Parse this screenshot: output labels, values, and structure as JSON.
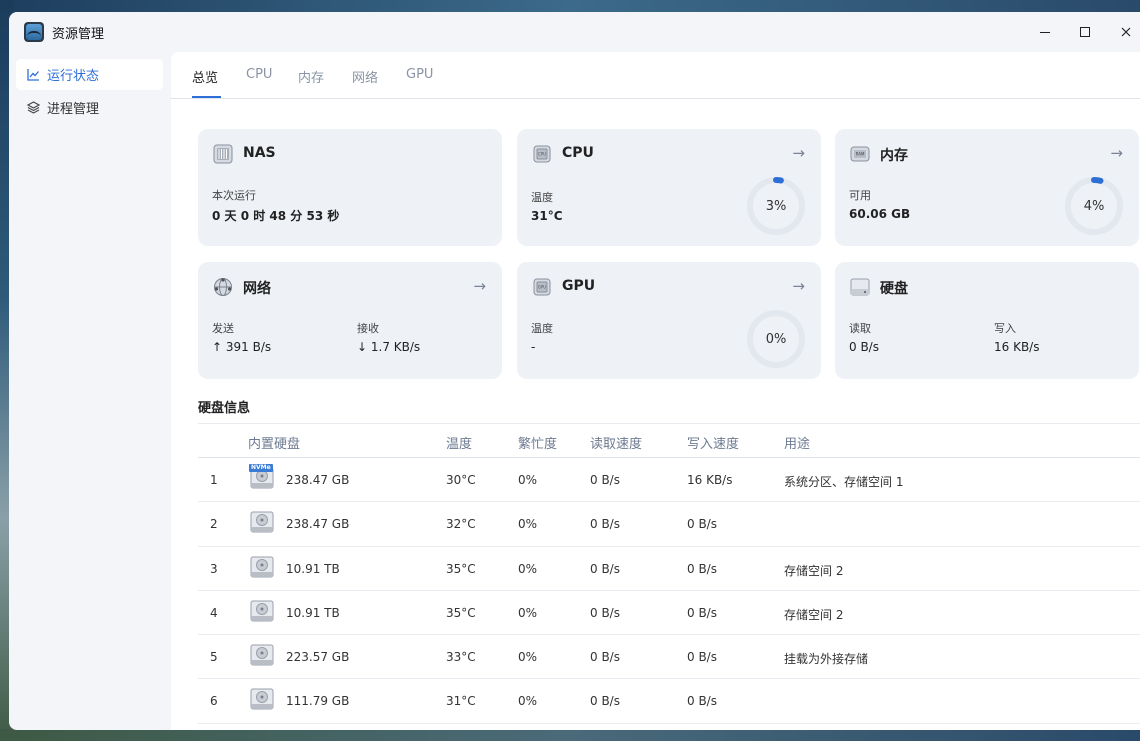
{
  "app": {
    "title": "资源管理"
  },
  "sidebar": {
    "items": [
      {
        "label": "运行状态",
        "icon": "chart-line-icon",
        "active": true
      },
      {
        "label": "进程管理",
        "icon": "layers-icon",
        "active": false
      }
    ]
  },
  "tabs": [
    {
      "label": "总览",
      "active": true
    },
    {
      "label": "CPU",
      "active": false
    },
    {
      "label": "内存",
      "active": false
    },
    {
      "label": "网络",
      "active": false
    },
    {
      "label": "GPU",
      "active": false
    }
  ],
  "cards": {
    "nas": {
      "title": "NAS",
      "label": "本次运行",
      "value": "0 天 0 时 48 分 53 秒"
    },
    "cpu": {
      "title": "CPU",
      "label": "温度",
      "value": "31°C",
      "percent_text": "3%",
      "percent": 3
    },
    "memory": {
      "title": "内存",
      "label": "可用",
      "value": "60.06 GB",
      "percent_text": "4%",
      "percent": 4
    },
    "network": {
      "title": "网络",
      "send_label": "发送",
      "send_value": "↑ 391 B/s",
      "recv_label": "接收",
      "recv_value": "↓ 1.7 KB/s"
    },
    "gpu": {
      "title": "GPU",
      "label": "温度",
      "value": "-",
      "percent_text": "0%",
      "percent": 0
    },
    "disk": {
      "title": "硬盘",
      "read_label": "读取",
      "read_value": "0 B/s",
      "write_label": "写入",
      "write_value": "16 KB/s"
    }
  },
  "disk_info": {
    "title": "硬盘信息",
    "headers": [
      "内置硬盘",
      "温度",
      "繁忙度",
      "读取速度",
      "写入速度",
      "用途"
    ],
    "rows": [
      {
        "idx": "1",
        "size": "238.47 GB",
        "temp": "30°C",
        "busy": "0%",
        "read": "0 B/s",
        "write": "16 KB/s",
        "usage": "系统分区、存储空间 1",
        "badge": "NVMe"
      },
      {
        "idx": "2",
        "size": "238.47 GB",
        "temp": "32°C",
        "busy": "0%",
        "read": "0 B/s",
        "write": "0 B/s",
        "usage": ""
      },
      {
        "idx": "3",
        "size": "10.91 TB",
        "temp": "35°C",
        "busy": "0%",
        "read": "0 B/s",
        "write": "0 B/s",
        "usage": "存储空间 2"
      },
      {
        "idx": "4",
        "size": "10.91 TB",
        "temp": "35°C",
        "busy": "0%",
        "read": "0 B/s",
        "write": "0 B/s",
        "usage": "存储空间 2"
      },
      {
        "idx": "5",
        "size": "223.57 GB",
        "temp": "33°C",
        "busy": "0%",
        "read": "0 B/s",
        "write": "0 B/s",
        "usage": "挂载为外接存储"
      },
      {
        "idx": "6",
        "size": "111.79 GB",
        "temp": "31°C",
        "busy": "0%",
        "read": "0 B/s",
        "write": "0 B/s",
        "usage": ""
      }
    ]
  },
  "colors": {
    "accent": "#2d6fd6",
    "card_bg": "#eef1f6",
    "ring_track": "#e3e7ee"
  }
}
